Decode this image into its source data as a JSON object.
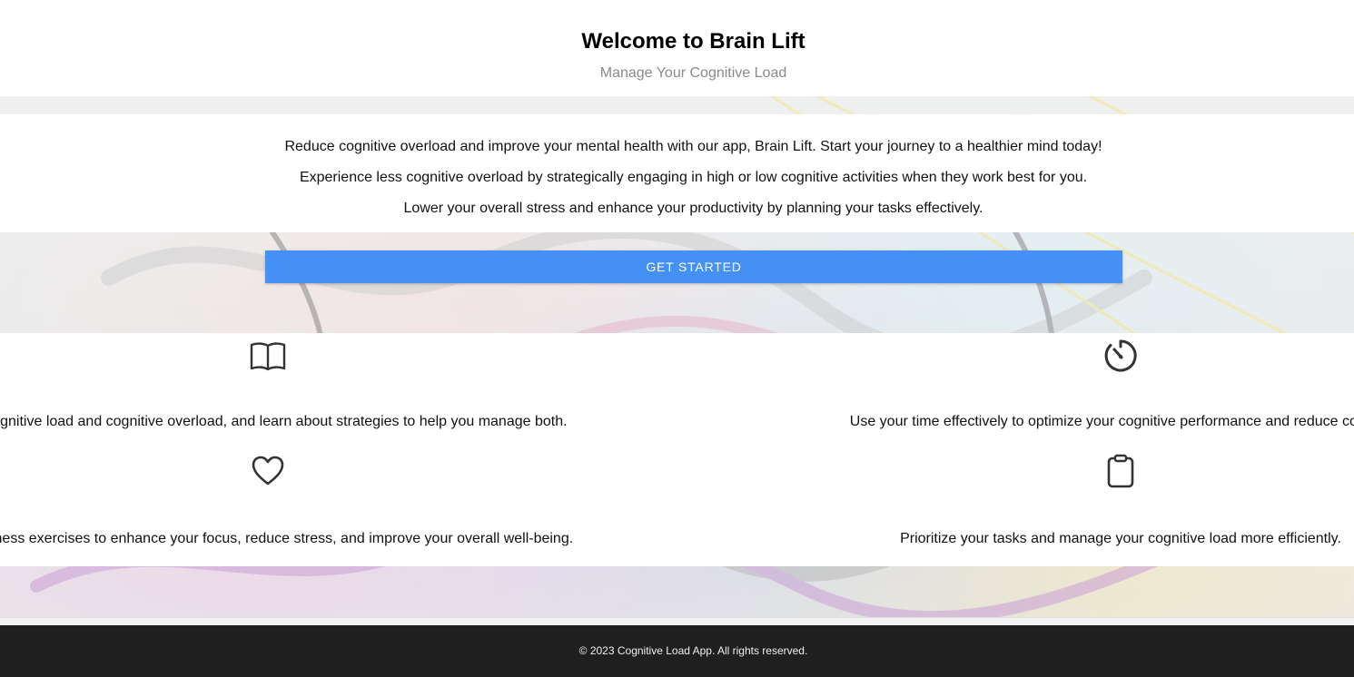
{
  "header": {
    "title": "Welcome to Brain Lift",
    "subtitle": "Manage Your Cognitive Load"
  },
  "intro": {
    "lines": [
      "Reduce cognitive overload and improve your mental health with our app, Brain Lift. Start your journey to a healthier mind today!",
      "Experience less cognitive overload by strategically engaging in high or low cognitive activities when they work best for you.",
      "Lower your overall stress and enhance your productivity by planning your tasks effectively."
    ]
  },
  "cta": {
    "label": "GET STARTED",
    "color": "#4490f5"
  },
  "features": [
    {
      "icon": "open-book-icon",
      "text": "ut cognitive load and cognitive overload, and learn about strategies to help you manage both."
    },
    {
      "icon": "timer-icon",
      "text": "Use your time effectively to optimize your cognitive performance and reduce cognitiv"
    },
    {
      "icon": "heart-icon",
      "text": "ndfulness exercises to enhance your focus, reduce stress, and improve your overall well-being."
    },
    {
      "icon": "clipboard-icon",
      "text": "Prioritize your tasks and manage your cognitive load more efficiently."
    }
  ],
  "footer": {
    "text": "© 2023 Cognitive Load App. All rights reserved.",
    "background": "#1f1f1f"
  }
}
